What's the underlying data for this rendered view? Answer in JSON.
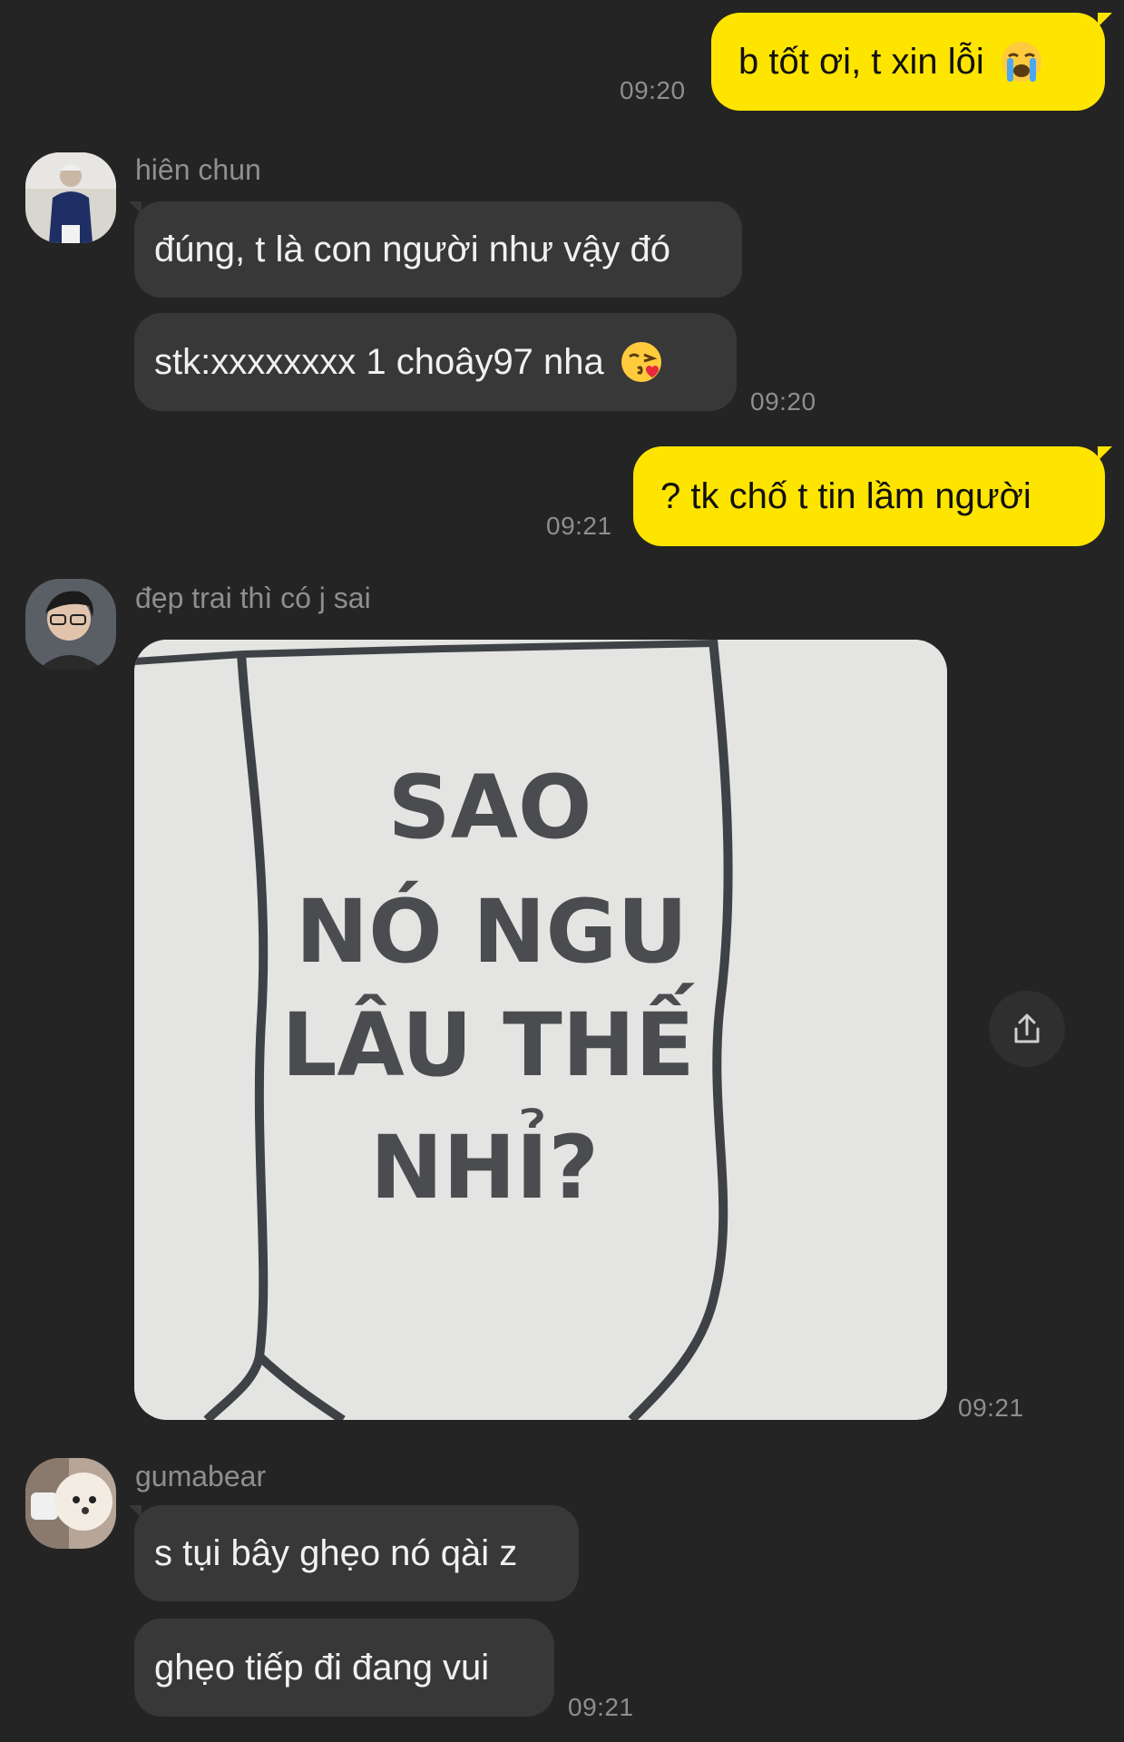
{
  "messages": {
    "m1": {
      "text": "b tốt ơi, t xin lỗi",
      "time": "09:20",
      "emoji": "loudly-crying-face"
    },
    "m2": {
      "sender": "hiên chun",
      "text": "đúng, t là con người như vậy đó"
    },
    "m3": {
      "text": "stk:xxxxxxxx 1 choây97 nha",
      "time": "09:20",
      "emoji": "face-blowing-kiss"
    },
    "m4": {
      "text": "? tk chố t tin lầm người",
      "time": "09:21"
    },
    "m5": {
      "sender": "đẹp trai thì có j sai",
      "time": "09:21",
      "image_text": {
        "line1": "SAO",
        "line2": "NÓ NGU",
        "line3": "LÂU THẾ",
        "line4": "NHỈ?"
      }
    },
    "m6": {
      "sender": "gumabear",
      "text": "s tụi bây ghẹo nó qài z"
    },
    "m7": {
      "text": "ghẹo tiếp đi đang vui",
      "time": "09:21"
    }
  },
  "colors": {
    "background": "#242424",
    "incoming_bubble": "#383838",
    "outgoing_bubble": "#fee500",
    "time_text": "#8e8e8e"
  },
  "icons": {
    "share": "share-icon"
  }
}
